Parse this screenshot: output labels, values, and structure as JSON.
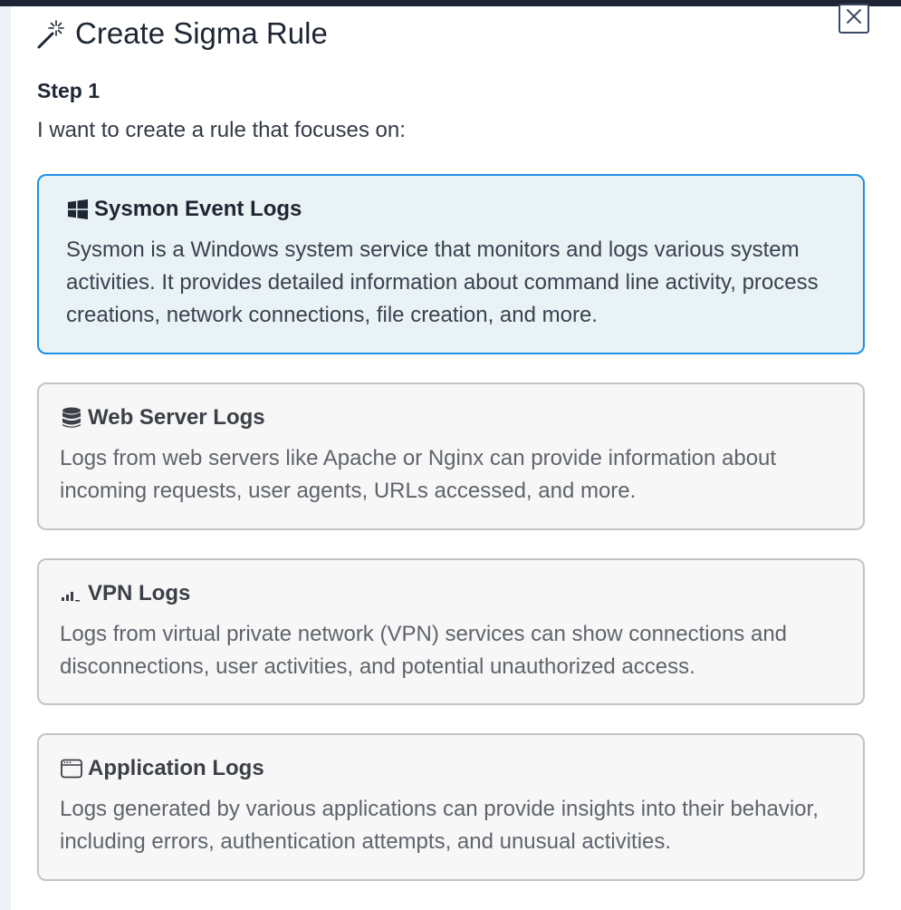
{
  "header": {
    "title": "Create Sigma Rule",
    "title_icon": "magic-wand-icon",
    "close_icon": "close-icon"
  },
  "step": {
    "label": "Step 1",
    "description": "I want to create a rule that focuses on:"
  },
  "options": [
    {
      "icon": "windows-icon",
      "title": "Sysmon Event Logs",
      "description": "Sysmon is a Windows system service that monitors and logs various system activities. It provides detailed information about command line activity, process creations, network connections, file creation, and more.",
      "selected": true
    },
    {
      "icon": "database-icon",
      "title": "Web Server Logs",
      "description": "Logs from web servers like Apache or Nginx can provide information about incoming requests, user agents, URLs accessed, and more.",
      "selected": false
    },
    {
      "icon": "signal-bars-icon",
      "title": "VPN Logs",
      "description": "Logs from virtual private network (VPN) services can show connections and disconnections, user activities, and potential unauthorized access.",
      "selected": false
    },
    {
      "icon": "app-window-icon",
      "title": "Application Logs",
      "description": "Logs generated by various applications can provide insights into their behavior, including errors, authentication attempts, and unusual activities.",
      "selected": false
    }
  ],
  "colors": {
    "selected_border": "#1f8fe6",
    "selected_background": "#e9f3f5",
    "normal_border": "#c4c4c4",
    "normal_background": "#f7f7f7",
    "topbar": "#1e2433"
  }
}
